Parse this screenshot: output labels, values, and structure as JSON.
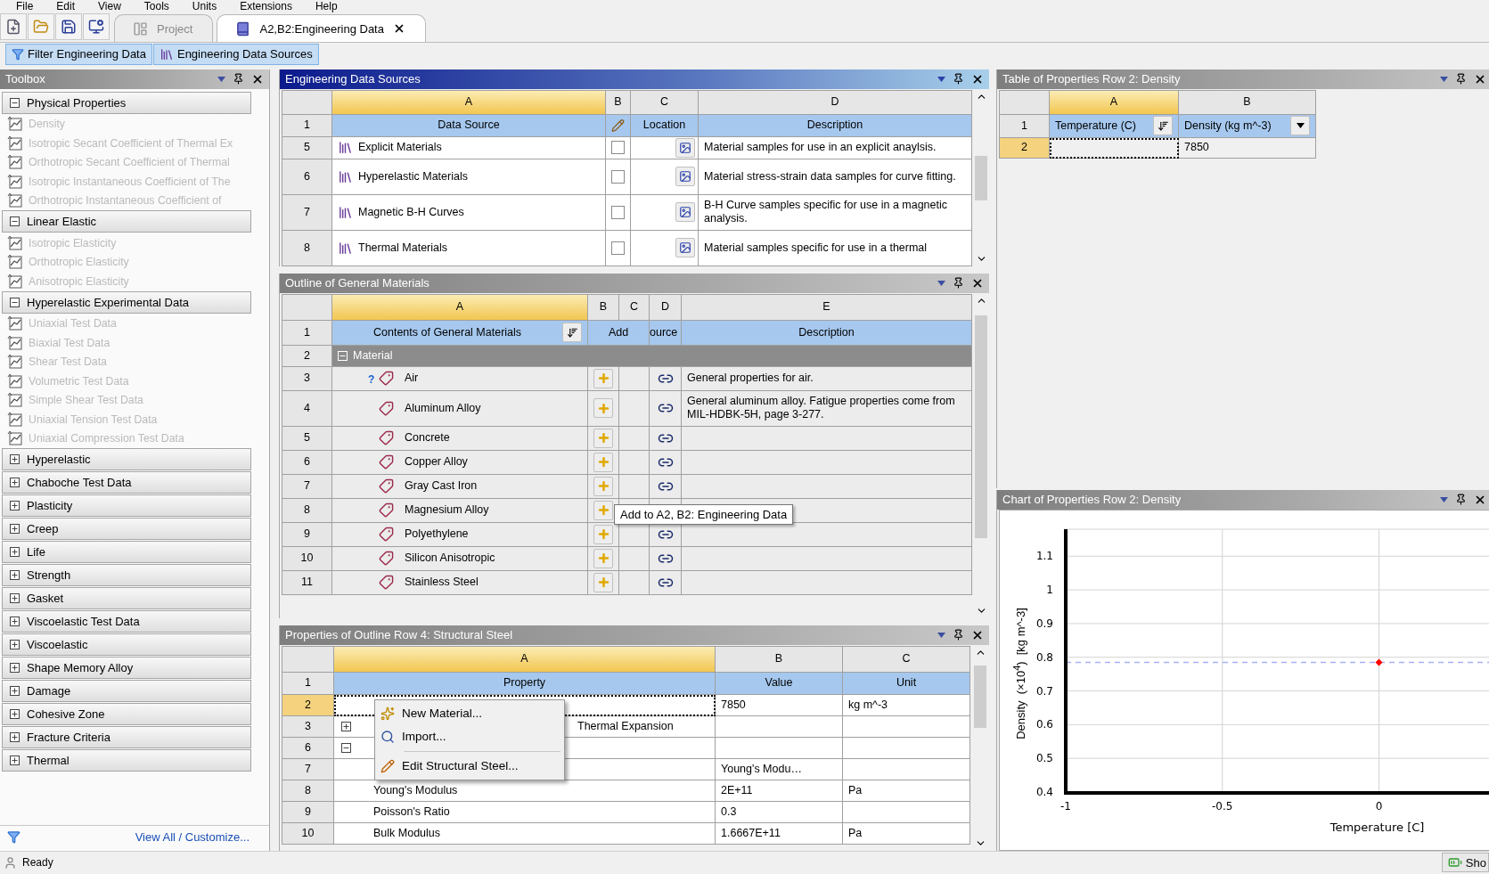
{
  "menu": [
    "File",
    "Edit",
    "View",
    "Tools",
    "Units",
    "Extensions",
    "Help"
  ],
  "document_tabs": [
    {
      "label": "Project",
      "selected": false
    },
    {
      "label": "A2,B2:Engineering Data",
      "selected": true
    }
  ],
  "view_toggles": [
    {
      "label": "Filter Engineering Data",
      "on": true
    },
    {
      "label": "Engineering Data Sources",
      "on": true
    }
  ],
  "toolbox": {
    "title": "Toolbox",
    "groups": [
      {
        "label": "Physical Properties",
        "expanded": true,
        "items": [
          {
            "label": "Density",
            "disabled": true
          },
          {
            "label": "Isotropic Secant Coefficient of Thermal Ex",
            "disabled": true
          },
          {
            "label": "Orthotropic Secant Coefficient of Thermal",
            "disabled": true
          },
          {
            "label": "Isotropic Instantaneous Coefficient of The",
            "disabled": true
          },
          {
            "label": "Orthotropic Instantaneous Coefficient of",
            "disabled": true
          }
        ]
      },
      {
        "label": "Linear Elastic",
        "expanded": true,
        "items": [
          {
            "label": "Isotropic Elasticity",
            "disabled": true
          },
          {
            "label": "Orthotropic Elasticity",
            "disabled": true
          },
          {
            "label": "Anisotropic Elasticity",
            "disabled": true
          }
        ]
      },
      {
        "label": "Hyperelastic Experimental Data",
        "expanded": true,
        "items": [
          {
            "label": "Uniaxial Test Data",
            "disabled": true
          },
          {
            "label": "Biaxial Test Data",
            "disabled": true
          },
          {
            "label": "Shear Test Data",
            "disabled": true
          },
          {
            "label": "Volumetric Test Data",
            "disabled": true
          },
          {
            "label": "Simple Shear Test Data",
            "disabled": true
          },
          {
            "label": "Uniaxial Tension Test Data",
            "disabled": true
          },
          {
            "label": "Uniaxial Compression Test Data",
            "disabled": true
          }
        ]
      },
      {
        "label": "Hyperelastic",
        "expanded": false
      },
      {
        "label": "Chaboche Test Data",
        "expanded": false
      },
      {
        "label": "Plasticity",
        "expanded": false
      },
      {
        "label": "Creep",
        "expanded": false
      },
      {
        "label": "Life",
        "expanded": false
      },
      {
        "label": "Strength",
        "expanded": false
      },
      {
        "label": "Gasket",
        "expanded": false
      },
      {
        "label": "Viscoelastic Test Data",
        "expanded": false
      },
      {
        "label": "Viscoelastic",
        "expanded": false
      },
      {
        "label": "Shape Memory Alloy",
        "expanded": false
      },
      {
        "label": "Damage",
        "expanded": false
      },
      {
        "label": "Cohesive Zone",
        "expanded": false
      },
      {
        "label": "Fracture Criteria",
        "expanded": false
      },
      {
        "label": "Thermal",
        "expanded": false
      }
    ],
    "footer_link": "View All / Customize..."
  },
  "sources": {
    "title": "Engineering Data Sources",
    "active": true,
    "columns": [
      {
        "label": "A",
        "selected": true
      },
      {
        "label": "B",
        "selected": false
      },
      {
        "label": "C",
        "selected": false
      },
      {
        "label": "D",
        "selected": false
      }
    ],
    "header": {
      "num": "1",
      "data_source": "Data Source",
      "location": "Location",
      "description": "Description"
    },
    "rows": [
      {
        "num": "5",
        "name": "Explicit Materials",
        "checked": false,
        "description": "Material samples for use in an explicit anaylsis."
      },
      {
        "num": "6",
        "name": "Hyperelastic Materials",
        "checked": false,
        "description": "Material stress-strain data samples for curve fitting."
      },
      {
        "num": "7",
        "name": "Magnetic B-H Curves",
        "checked": false,
        "description": "B-H Curve samples specific for use in a magnetic analysis."
      },
      {
        "num": "8",
        "name": "Thermal Materials",
        "checked": false,
        "description": "Material samples specific for use in a thermal"
      }
    ]
  },
  "outline": {
    "title": "Outline of General Materials",
    "active": false,
    "columns": [
      {
        "label": "A",
        "selected": true
      },
      {
        "label": "B",
        "selected": false
      },
      {
        "label": "C",
        "selected": false
      },
      {
        "label": "D",
        "selected": false
      },
      {
        "label": "E",
        "selected": false
      }
    ],
    "header": {
      "num": "1",
      "contents": "Contents of General Materials",
      "add": "Add",
      "source": "ource",
      "description": "Description"
    },
    "rows": [
      {
        "num": "2",
        "label": "Material",
        "expanded": true,
        "children": [
          {
            "num": "3",
            "name": "Air",
            "note": "?",
            "description": "General properties for air."
          },
          {
            "num": "4",
            "name": "Aluminum Alloy",
            "description": "General aluminum alloy. Fatigue properties come from MIL-HDBK-5H, page 3-277."
          },
          {
            "num": "5",
            "name": "Concrete"
          },
          {
            "num": "6",
            "name": "Copper Alloy"
          },
          {
            "num": "7",
            "name": "Gray Cast Iron"
          },
          {
            "num": "8",
            "name": "Magnesium Alloy"
          },
          {
            "num": "9",
            "name": "Polyethylene"
          },
          {
            "num": "10",
            "name": "Silicon Anisotropic"
          },
          {
            "num": "11",
            "name": "Stainless Steel"
          }
        ]
      }
    ],
    "tooltip": "Add to A2, B2: Engineering Data"
  },
  "properties": {
    "title": "Properties of Outline Row 4: Structural Steel",
    "active": false,
    "columns": [
      {
        "label": "A",
        "selected": true
      },
      {
        "label": "B",
        "selected": false
      },
      {
        "label": "C",
        "selected": false
      }
    ],
    "header": {
      "num": "1",
      "property": "Property",
      "value": "Value",
      "unit": "Unit"
    },
    "rows": [
      {
        "num": "2",
        "selected": true,
        "value": "7850",
        "unit": "kg m^-3"
      },
      {
        "num": "3",
        "selected": false,
        "expanded": false,
        "name": "Thermal Expansion"
      },
      {
        "num": "6",
        "selected": false,
        "expanded": true,
        "children": [
          {
            "num": "7",
            "selected": false,
            "value": "Young's Modu…"
          },
          {
            "num": "8",
            "selected": false,
            "name": "Young's Modulus",
            "value": "2E+11",
            "unit": "Pa"
          },
          {
            "num": "9",
            "selected": false,
            "name": "Poisson's Ratio",
            "value": "0.3"
          },
          {
            "num": "10",
            "selected": false,
            "name": "Bulk Modulus",
            "value": "1.6667E+11",
            "unit": "Pa"
          }
        ]
      }
    ],
    "context_menu": [
      {
        "label": "New Material..."
      },
      {
        "label": "Import..."
      },
      {
        "label": "Edit Structural Steel...",
        "separator_before": true
      }
    ]
  },
  "property_table": {
    "title": "Table of Properties Row 2: Density",
    "active": false,
    "columns": [
      {
        "label": "A",
        "selected": true
      },
      {
        "label": "B",
        "selected": false
      }
    ],
    "header": {
      "num": "1",
      "cells": [
        "Temperature (C)",
        "Density (kg m^-3)"
      ]
    },
    "rows": [
      {
        "num": "2",
        "selected": true,
        "value": "7850"
      }
    ]
  },
  "chart": {
    "title": "Chart of Properties Row 2: Density",
    "active": false,
    "chart_data": {
      "type": "scatter",
      "xlabel": "Temperature  [C]",
      "ylabel": "Density  (×10$^{4}$)  [kg m^-3]",
      "x": [
        0
      ],
      "series": [
        {
          "color": "#ff0000",
          "values": [
            0.785
          ]
        }
      ],
      "grid": true,
      "ref_lines": [
        {
          "value": 0.785,
          "axis": "y",
          "color": "#a8aef8"
        }
      ],
      "xlim": [
        -1,
        0.357
      ],
      "ylim": [
        0.4,
        1.18
      ],
      "xticks": [
        -1,
        -0.5,
        0
      ],
      "yticks": [
        0.4,
        0.5,
        0.6,
        0.7,
        0.8,
        0.9,
        1,
        1.1
      ]
    }
  },
  "status_bar": {
    "text": "Ready",
    "button": "Sho"
  }
}
